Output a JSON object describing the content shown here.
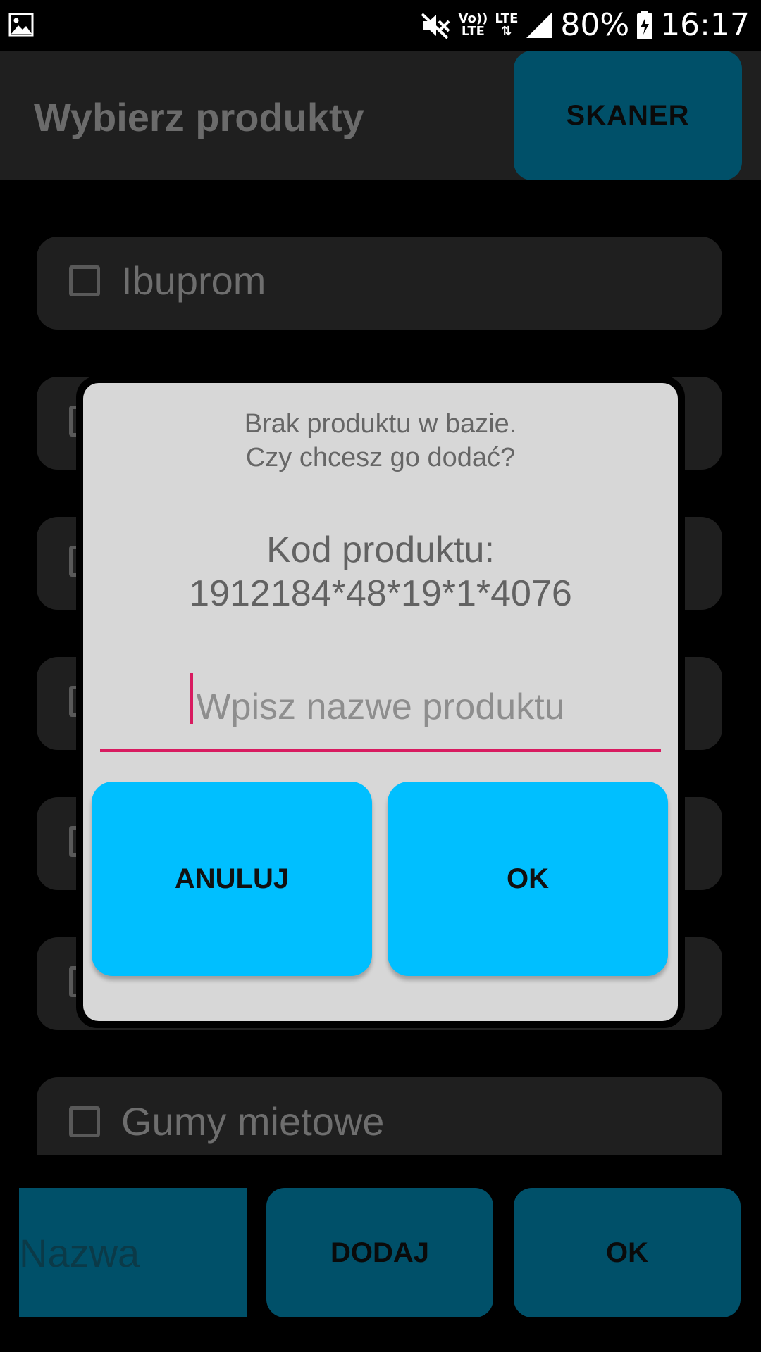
{
  "status_bar": {
    "battery": "80%",
    "time": "16:17",
    "volte_top": "Vo))",
    "volte_bottom": "LTE",
    "lte": "LTE",
    "icons": [
      "gallery-icon",
      "mute-icon",
      "volte-icon",
      "lte-icon",
      "signal-icon",
      "battery-charging-icon"
    ]
  },
  "appbar": {
    "title": "Wybierz produkty",
    "scanner_label": "SKANER"
  },
  "list": {
    "items": [
      {
        "label": "Ibuprom"
      },
      {
        "label": ""
      },
      {
        "label": ""
      },
      {
        "label": ""
      },
      {
        "label": ""
      },
      {
        "label": ""
      },
      {
        "label": "Gumy mietowe"
      }
    ]
  },
  "bottom": {
    "name_placeholder": "Nazwa",
    "add_label": "DODAJ",
    "ok_label": "OK"
  },
  "dialog": {
    "message_line1": "Brak produktu w bazie.",
    "message_line2": "Czy chcesz go dodać?",
    "code_label": "Kod produktu:",
    "code_value": "1912184*48*19*1*4076",
    "input_placeholder": "Wpisz nazwe produktu",
    "cancel_label": "ANULUJ",
    "ok_label": "OK"
  },
  "colors": {
    "accent_dark": "#005069",
    "accent_bright": "#00bfff",
    "caret": "#d81b60"
  }
}
